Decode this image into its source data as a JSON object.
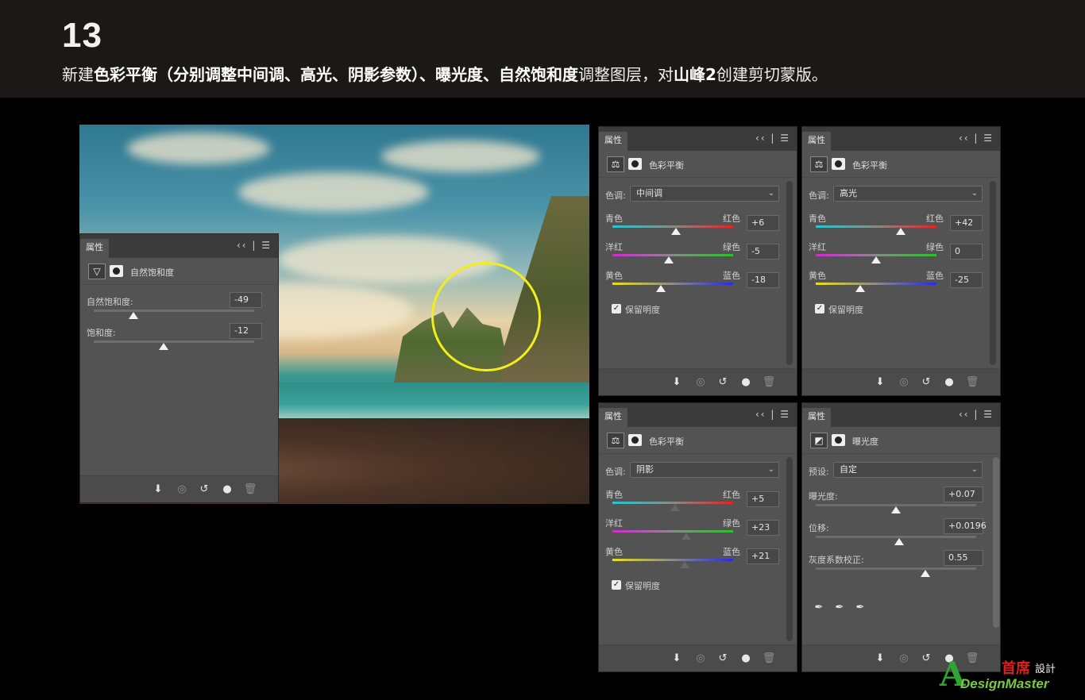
{
  "header": {
    "step_number": "13",
    "instruction": {
      "p1": "新建",
      "b1": "色彩平衡（分别调整中间调、高光、阴影参数）、曝光度、自然饱和度",
      "p2": "调整图层，对",
      "b2": "山峰2",
      "p3": "创建剪切蒙版。"
    }
  },
  "common": {
    "tab_label": "属性",
    "panel_menu": "‹‹ | ☰",
    "preserve_label": "保留明度",
    "tone_label": "色调:",
    "cyan": "青色",
    "red": "红色",
    "magenta": "洋红",
    "green": "绿色",
    "yellow": "黄色",
    "blue": "蓝色"
  },
  "panels": {
    "vibrance": {
      "title": "自然饱和度",
      "vibrance_label": "自然饱和度:",
      "vibrance_value": "-49",
      "saturation_label": "饱和度:",
      "saturation_value": "-12",
      "levels": {
        "vibrance": -49,
        "saturation": -12
      }
    },
    "cb_midtones": {
      "title": "色彩平衡",
      "tone": "中间调",
      "values": [
        "+6",
        "-5",
        "-18"
      ],
      "levels": [
        6,
        -5,
        -18
      ]
    },
    "cb_highlights": {
      "title": "色彩平衡",
      "tone": "高光",
      "values": [
        "+42",
        "0",
        "-25"
      ],
      "levels": [
        42,
        0,
        -25
      ]
    },
    "cb_shadows": {
      "title": "色彩平衡",
      "tone": "阴影",
      "values": [
        "+5",
        "+23",
        "+21"
      ],
      "levels": [
        5,
        23,
        21
      ]
    },
    "exposure": {
      "title": "曝光度",
      "preset_label": "预设:",
      "preset_value": "自定",
      "exposure_label": "曝光度:",
      "exposure_value": "+0.07",
      "offset_label": "位移:",
      "offset_value": "+0.0196",
      "gamma_label": "灰度系数校正:",
      "gamma_value": "0.55"
    }
  },
  "icons": {
    "adjustment_cb": "balance-scale-icon",
    "adjustment_vibrance": "triangle-icon",
    "adjustment_exposure": "exposure-icon",
    "footer": [
      "clip-to-layer-icon",
      "view-previous-icon",
      "reset-icon",
      "visibility-eye-icon",
      "trash-icon"
    ]
  },
  "logo": {
    "letter": "A",
    "cn_main": "首席",
    "cn_sub": "設計",
    "en": "DesignMaster"
  }
}
